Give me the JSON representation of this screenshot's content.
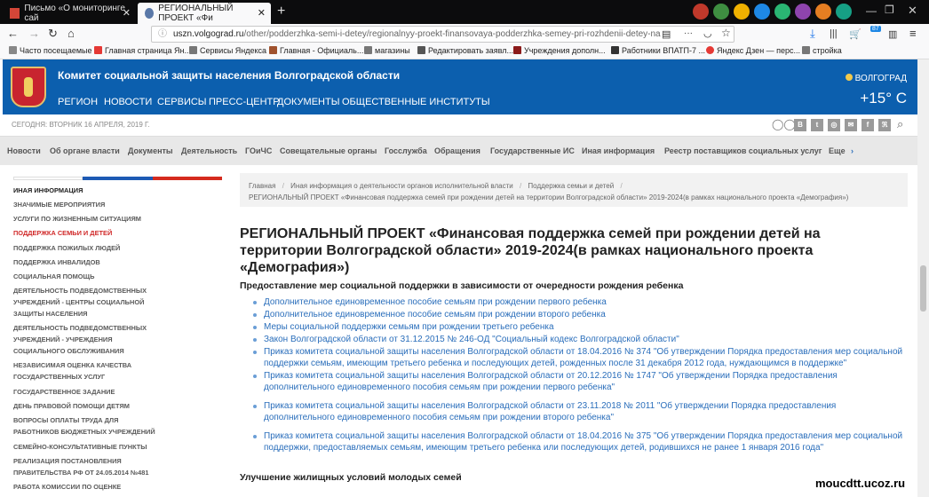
{
  "browser": {
    "tabs": [
      {
        "label": "Письмо «О мониторинге сай",
        "active": false
      },
      {
        "label": "РЕГИОНАЛЬНЫЙ ПРОЕКТ «Фи",
        "active": true
      }
    ],
    "new_tab": "+",
    "url_host": "uszn.volgograd.ru",
    "url_path": "/other/podderzhka-semi-i-detey/regionalnyy-proekt-finansovaya-podderzhka-semey-pri-rozhdenii-detey-na",
    "ext_count": "87",
    "bookmarks": [
      "Часто посещаемые",
      "Главная страница Ян...",
      "Сервисы Яндекса",
      "Главная - Официаль...",
      "магазины",
      "Редактировать заявл...",
      "Учреждения дополн...",
      "Работники ВПАТП-7 ...",
      "Яндекс Дзен — перс...",
      "стройка"
    ]
  },
  "site": {
    "title": "Комитет социальной защиты населения Волгоградской области",
    "nav": [
      "РЕГИОН",
      "НОВОСТИ",
      "СЕРВИСЫ",
      "ПРЕСС-ЦЕНТР",
      "ДОКУМЕНТЫ",
      "ОБЩЕСТВЕННЫЕ ИНСТИТУТЫ"
    ],
    "city": "ВОЛГОГРАД",
    "temperature": "+15° C",
    "date": "СЕГОДНЯ: ВТОРНИК 16 АПРЕЛЯ, 2019 Г.",
    "social": [
      "В",
      "t",
      "◎",
      "✉",
      "f",
      "ℜ"
    ],
    "secondary_nav": [
      "Новости",
      "Об органе власти",
      "Документы",
      "Деятельность",
      "ГОиЧС",
      "Совещательные органы",
      "Госслужба",
      "Обращения",
      "Государственные ИС",
      "Иная информация",
      "Реестр поставщиков социальных услуг",
      "Еще"
    ]
  },
  "sidebar": {
    "items": [
      {
        "label": "ИНАЯ ИНФОРМАЦИЯ",
        "state": "head"
      },
      {
        "label": "ЗНАЧИМЫЕ МЕРОПРИЯТИЯ",
        "state": ""
      },
      {
        "label": "УСЛУГИ ПО ЖИЗНЕННЫМ СИТУАЦИЯМ",
        "state": ""
      },
      {
        "label": "ПОДДЕРЖКА СЕМЬИ И ДЕТЕЙ",
        "state": "active"
      },
      {
        "label": "ПОДДЕРЖКА ПОЖИЛЫХ ЛЮДЕЙ",
        "state": ""
      },
      {
        "label": "ПОДДЕРЖКА ИНВАЛИДОВ",
        "state": ""
      },
      {
        "label": "СОЦИАЛЬНАЯ ПОМОЩЬ",
        "state": ""
      },
      {
        "label": "ДЕЯТЕЛЬНОСТЬ ПОДВЕДОМСТВЕННЫХ УЧРЕЖДЕНИЙ - ЦЕНТРЫ СОЦИАЛЬНОЙ ЗАЩИТЫ НАСЕЛЕНИЯ",
        "state": ""
      },
      {
        "label": "ДЕЯТЕЛЬНОСТЬ ПОДВЕДОМСТВЕННЫХ УЧРЕЖДЕНИЙ - УЧРЕЖДЕНИЯ СОЦИАЛЬНОГО ОБСЛУЖИВАНИЯ",
        "state": ""
      },
      {
        "label": "НЕЗАВИСИМАЯ ОЦЕНКА КАЧЕСТВА ГОСУДАРСТВЕННЫХ УСЛУГ",
        "state": ""
      },
      {
        "label": "ГОСУДАРСТВЕННОЕ ЗАДАНИЕ",
        "state": ""
      },
      {
        "label": "ДЕНЬ ПРАВОВОЙ ПОМОЩИ ДЕТЯМ",
        "state": ""
      },
      {
        "label": "ВОПРОСЫ ОПЛАТЫ ТРУДА ДЛЯ РАБОТНИКОВ БЮДЖЕТНЫХ УЧРЕЖДЕНИЙ",
        "state": ""
      },
      {
        "label": "СЕМЕЙНО-КОНСУЛЬТАТИВНЫЕ ПУНКТЫ",
        "state": ""
      },
      {
        "label": "РЕАЛИЗАЦИЯ ПОСТАНОВЛЕНИЯ ПРАВИТЕЛЬСТВА РФ ОТ 24.05.2014 №481",
        "state": ""
      },
      {
        "label": "РАБОТА КОМИССИИ ПО ОЦЕНКЕ",
        "state": ""
      }
    ]
  },
  "breadcrumb": {
    "line1": [
      "Главная",
      "Иная информация о деятельности органов исполнительной власти",
      "Поддержка семьи и детей"
    ],
    "line2": "РЕГИОНАЛЬНЫЙ ПРОЕКТ «Финансовая поддержка семей при рождении детей на территории Волгоградской области» 2019-2024(в рамках национального проекта «Демография»)"
  },
  "content": {
    "heading": "РЕГИОНАЛЬНЫЙ ПРОЕКТ «Финансовая поддержка семей при рождении детей на территории Волгоградской области» 2019-2024(в рамках национального проекта «Демография»)",
    "section1_title": "Предоставление мер социальной поддержки в зависимости от очередности рождения ребенка",
    "links": [
      "Дополнительное единовременное пособие семьям при рождении первого ребенка",
      "Дополнительное единовременное пособие семьям при рождении второго ребенка",
      "Меры социальной поддержки семьям при рождении третьего ребенка",
      "Закон Волгоградской области от 31.12.2015 № 246-ОД \"Социальный кодекс Волгоградской области\"",
      "Приказ комитета социальной защиты населения Волгоградской области от 18.04.2016 № 374 \"Об утверждении Порядка предоставления мер социальной поддержки семьям, имеющим третьего ребенка и последующих детей, рожденных после 31 декабря 2012 года, нуждающимся в поддержке\"",
      "Приказ комитета социальной защиты населения Волгоградской области от 20.12.2016 № 1747 \"Об утверждении Порядка предоставления дополнительного единовременного пособия семьям при рождении первого ребенка\"",
      "Приказ комитета социальной защиты населения Волгоградской области от 23.11.2018 № 2011 \"Об утверждении Порядка предоставления дополнительного единовременного пособия семьям при рождении второго ребенка\"",
      "Приказ комитета социальной защиты населения Волгоградской области от 18.04.2016 № 375 \"Об утверждении Порядка предоставления мер социальной поддержки, предоставляемых семьям, имеющим третьего ребенка или последующих детей, родившихся не ранее 1 января 2016 года\""
    ],
    "section2_title": "Улучшение жилищных условий молодых семей"
  },
  "watermark": "moucdtt.ucoz.ru",
  "colors": {
    "header_blue": "#0c5fae",
    "link_blue": "#2a6ebb",
    "active_red": "#d02828"
  }
}
